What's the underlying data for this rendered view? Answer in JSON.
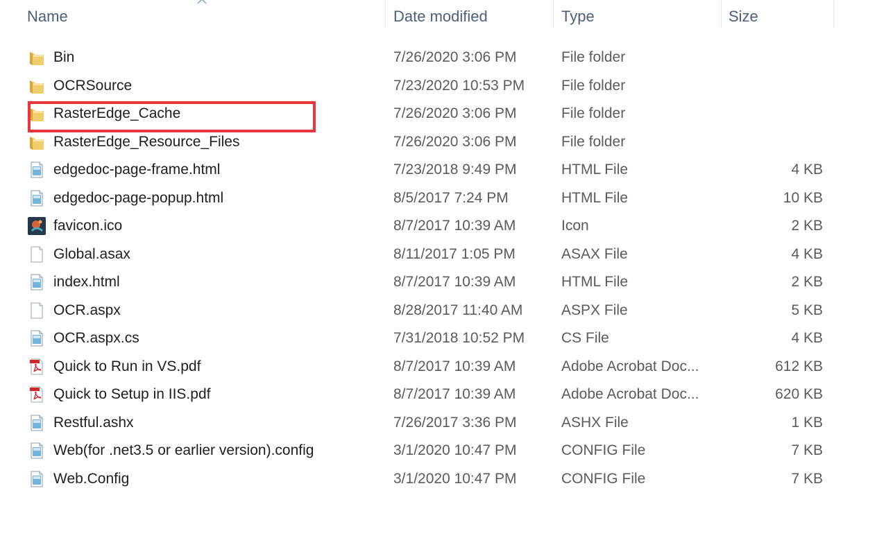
{
  "columns": {
    "name": "Name",
    "date": "Date modified",
    "type": "Type",
    "size": "Size"
  },
  "colors": {
    "header_text": "#4c607a",
    "highlight": "#e8383d",
    "folder": "#e9c45b"
  },
  "files": [
    {
      "name": "Bin",
      "date": "7/26/2020 3:06 PM",
      "type": "File folder",
      "size": "",
      "icon": "folder-icon"
    },
    {
      "name": "OCRSource",
      "date": "7/23/2020 10:53 PM",
      "type": "File folder",
      "size": "",
      "icon": "folder-icon"
    },
    {
      "name": "RasterEdge_Cache",
      "date": "7/26/2020 3:06 PM",
      "type": "File folder",
      "size": "",
      "icon": "folder-icon"
    },
    {
      "name": "RasterEdge_Resource_Files",
      "date": "7/26/2020 3:06 PM",
      "type": "File folder",
      "size": "",
      "icon": "folder-icon"
    },
    {
      "name": "edgedoc-page-frame.html",
      "date": "7/23/2018 9:49 PM",
      "type": "HTML File",
      "size": "4 KB",
      "icon": "html-file-icon"
    },
    {
      "name": "edgedoc-page-popup.html",
      "date": "8/5/2017 7:24 PM",
      "type": "HTML File",
      "size": "10 KB",
      "icon": "html-file-icon"
    },
    {
      "name": "favicon.ico",
      "date": "8/7/2017 10:39 AM",
      "type": "Icon",
      "size": "2 KB",
      "icon": "favicon-icon"
    },
    {
      "name": "Global.asax",
      "date": "8/11/2017 1:05 PM",
      "type": "ASAX File",
      "size": "4 KB",
      "icon": "blank-file-icon"
    },
    {
      "name": "index.html",
      "date": "8/7/2017 10:39 AM",
      "type": "HTML File",
      "size": "2 KB",
      "icon": "html-file-icon"
    },
    {
      "name": "OCR.aspx",
      "date": "8/28/2017 11:40 AM",
      "type": "ASPX File",
      "size": "5 KB",
      "icon": "blank-file-icon"
    },
    {
      "name": "OCR.aspx.cs",
      "date": "7/31/2018 10:52 PM",
      "type": "CS File",
      "size": "4 KB",
      "icon": "html-file-icon"
    },
    {
      "name": "Quick to Run in VS.pdf",
      "date": "8/7/2017 10:39 AM",
      "type": "Adobe Acrobat Doc...",
      "size": "612 KB",
      "icon": "pdf-file-icon"
    },
    {
      "name": "Quick to Setup in IIS.pdf",
      "date": "8/7/2017 10:39 AM",
      "type": "Adobe Acrobat Doc...",
      "size": "620 KB",
      "icon": "pdf-file-icon"
    },
    {
      "name": "Restful.ashx",
      "date": "7/26/2017 3:36 PM",
      "type": "ASHX File",
      "size": "1 KB",
      "icon": "html-file-icon"
    },
    {
      "name": "Web(for .net3.5 or earlier version).config",
      "date": "3/1/2020 10:47 PM",
      "type": "CONFIG File",
      "size": "7 KB",
      "icon": "html-file-icon"
    },
    {
      "name": "Web.Config",
      "date": "3/1/2020 10:47 PM",
      "type": "CONFIG File",
      "size": "7 KB",
      "icon": "html-file-icon"
    }
  ],
  "highlighted_item": "RasterEdge_Cache"
}
